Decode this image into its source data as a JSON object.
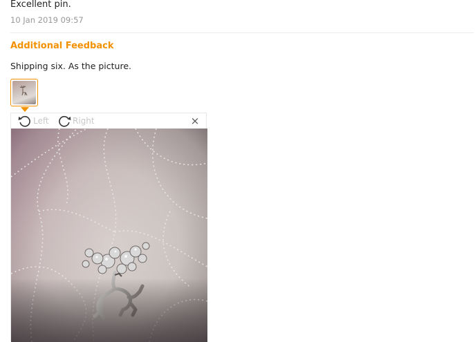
{
  "review": {
    "text": "Excellent pin.",
    "date": "10 Jan 2019 09:57"
  },
  "additional_feedback": {
    "heading": "Additional Feedback",
    "text": "Shipping six. As the picture.",
    "thumbnail_selected": true
  },
  "viewer": {
    "rotate_left_label": "Left",
    "rotate_right_label": "Right",
    "close_glyph": "×",
    "icons": {
      "rotate_left": "rotate-left-icon",
      "rotate_right": "rotate-right-icon",
      "close": "close-icon"
    }
  },
  "colors": {
    "accent": "#f29200",
    "date_text": "#999999",
    "disabled_label": "#c8c8c8"
  }
}
